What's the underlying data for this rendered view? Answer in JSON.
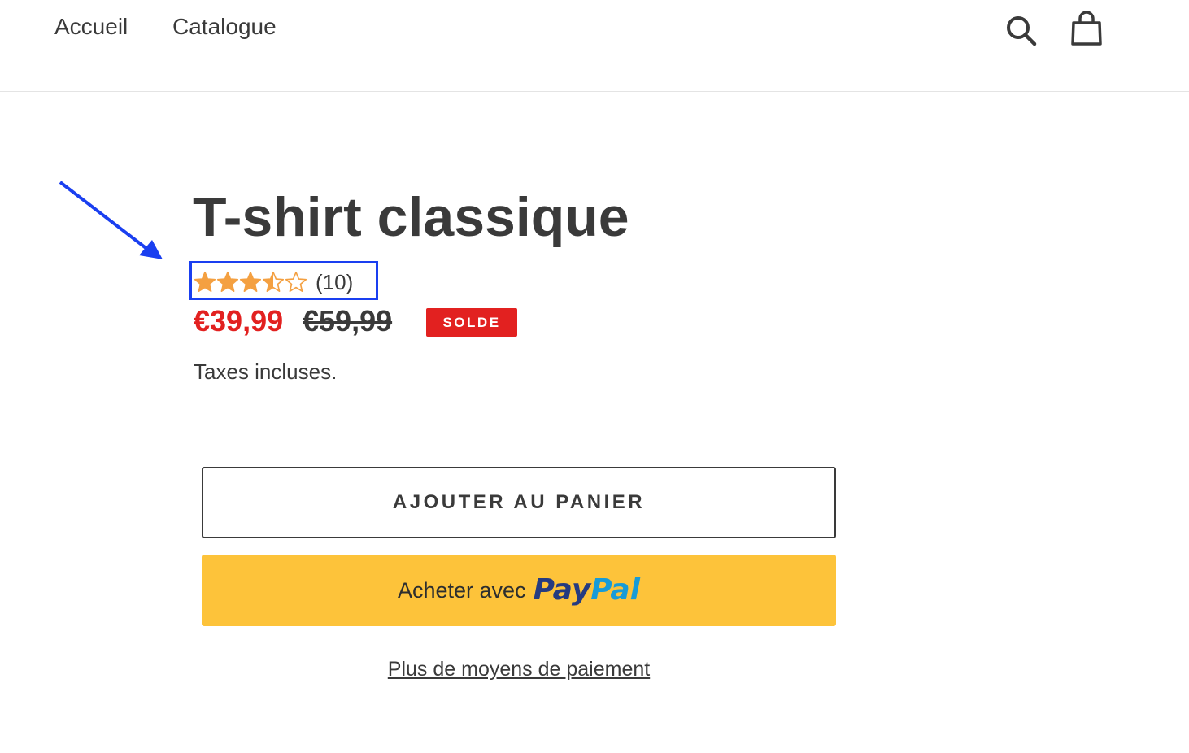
{
  "header": {
    "nav": [
      {
        "label": "Accueil"
      },
      {
        "label": "Catalogue"
      }
    ],
    "icons": {
      "search": "search-icon",
      "cart": "cart-icon"
    }
  },
  "product": {
    "title": "T-shirt classique",
    "rating": {
      "value": 3.5,
      "max": 5,
      "count_label": "(10)",
      "star_color": "#f4a041"
    },
    "price": {
      "sale": "€39,99",
      "regular": "€59,99"
    },
    "badge": "SOLDE",
    "tax_note": "Taxes incluses."
  },
  "actions": {
    "add_to_cart": "AJOUTER AU PANIER",
    "paypal_prefix": "Acheter avec",
    "paypal_logo_pay": "Pay",
    "paypal_logo_pal": "Pal",
    "more_payments": "Plus de moyens de paiement"
  },
  "colors": {
    "sale_red": "#e22120",
    "paypal_yellow": "#fdc33a",
    "annotation_blue": "#1a3ff0",
    "text": "#3a3a3a"
  }
}
